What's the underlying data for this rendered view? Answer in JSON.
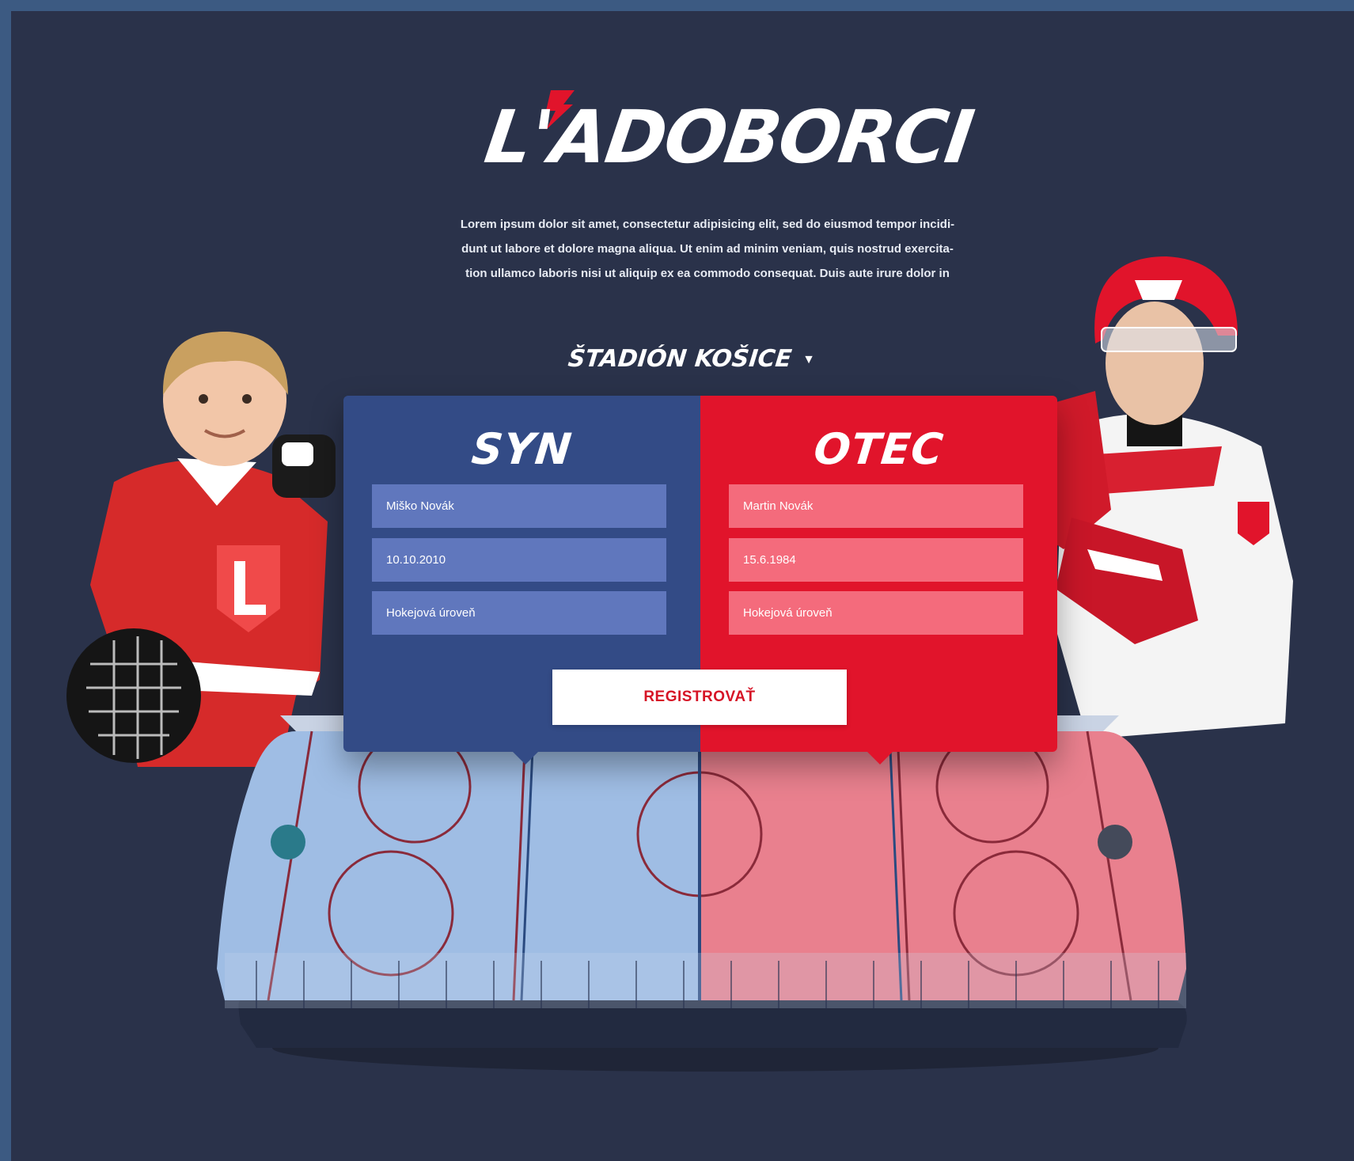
{
  "brand": {
    "name": "L'ADOBORCI",
    "accent_color": "#e1142b"
  },
  "intro": {
    "lines": [
      "Lorem ipsum dolor sit amet, consectetur adipisicing elit, sed do eiusmod tempor incidi-",
      "dunt ut labore et dolore magna aliqua. Ut enim ad minim veniam, quis nostrud exercita-",
      "tion ullamco laboris nisi ut aliquip ex ea commodo consequat. Duis aute irure dolor in"
    ]
  },
  "stadium_select": {
    "label": "ŠTADIÓN KOŠICE",
    "icon": "caret-down-icon"
  },
  "son": {
    "title": "SYN",
    "color": "#334b86",
    "fields": {
      "name": "Miško Novák",
      "birthdate": "10.10.2010",
      "level": "Hokejová úroveň"
    }
  },
  "father": {
    "title": "OTEC",
    "color": "#e1142b",
    "fields": {
      "name": "Martin Novák",
      "birthdate": "15.6.1984",
      "level": "Hokejová úroveň"
    }
  },
  "register_button": {
    "label": "REGISTROVAŤ"
  }
}
